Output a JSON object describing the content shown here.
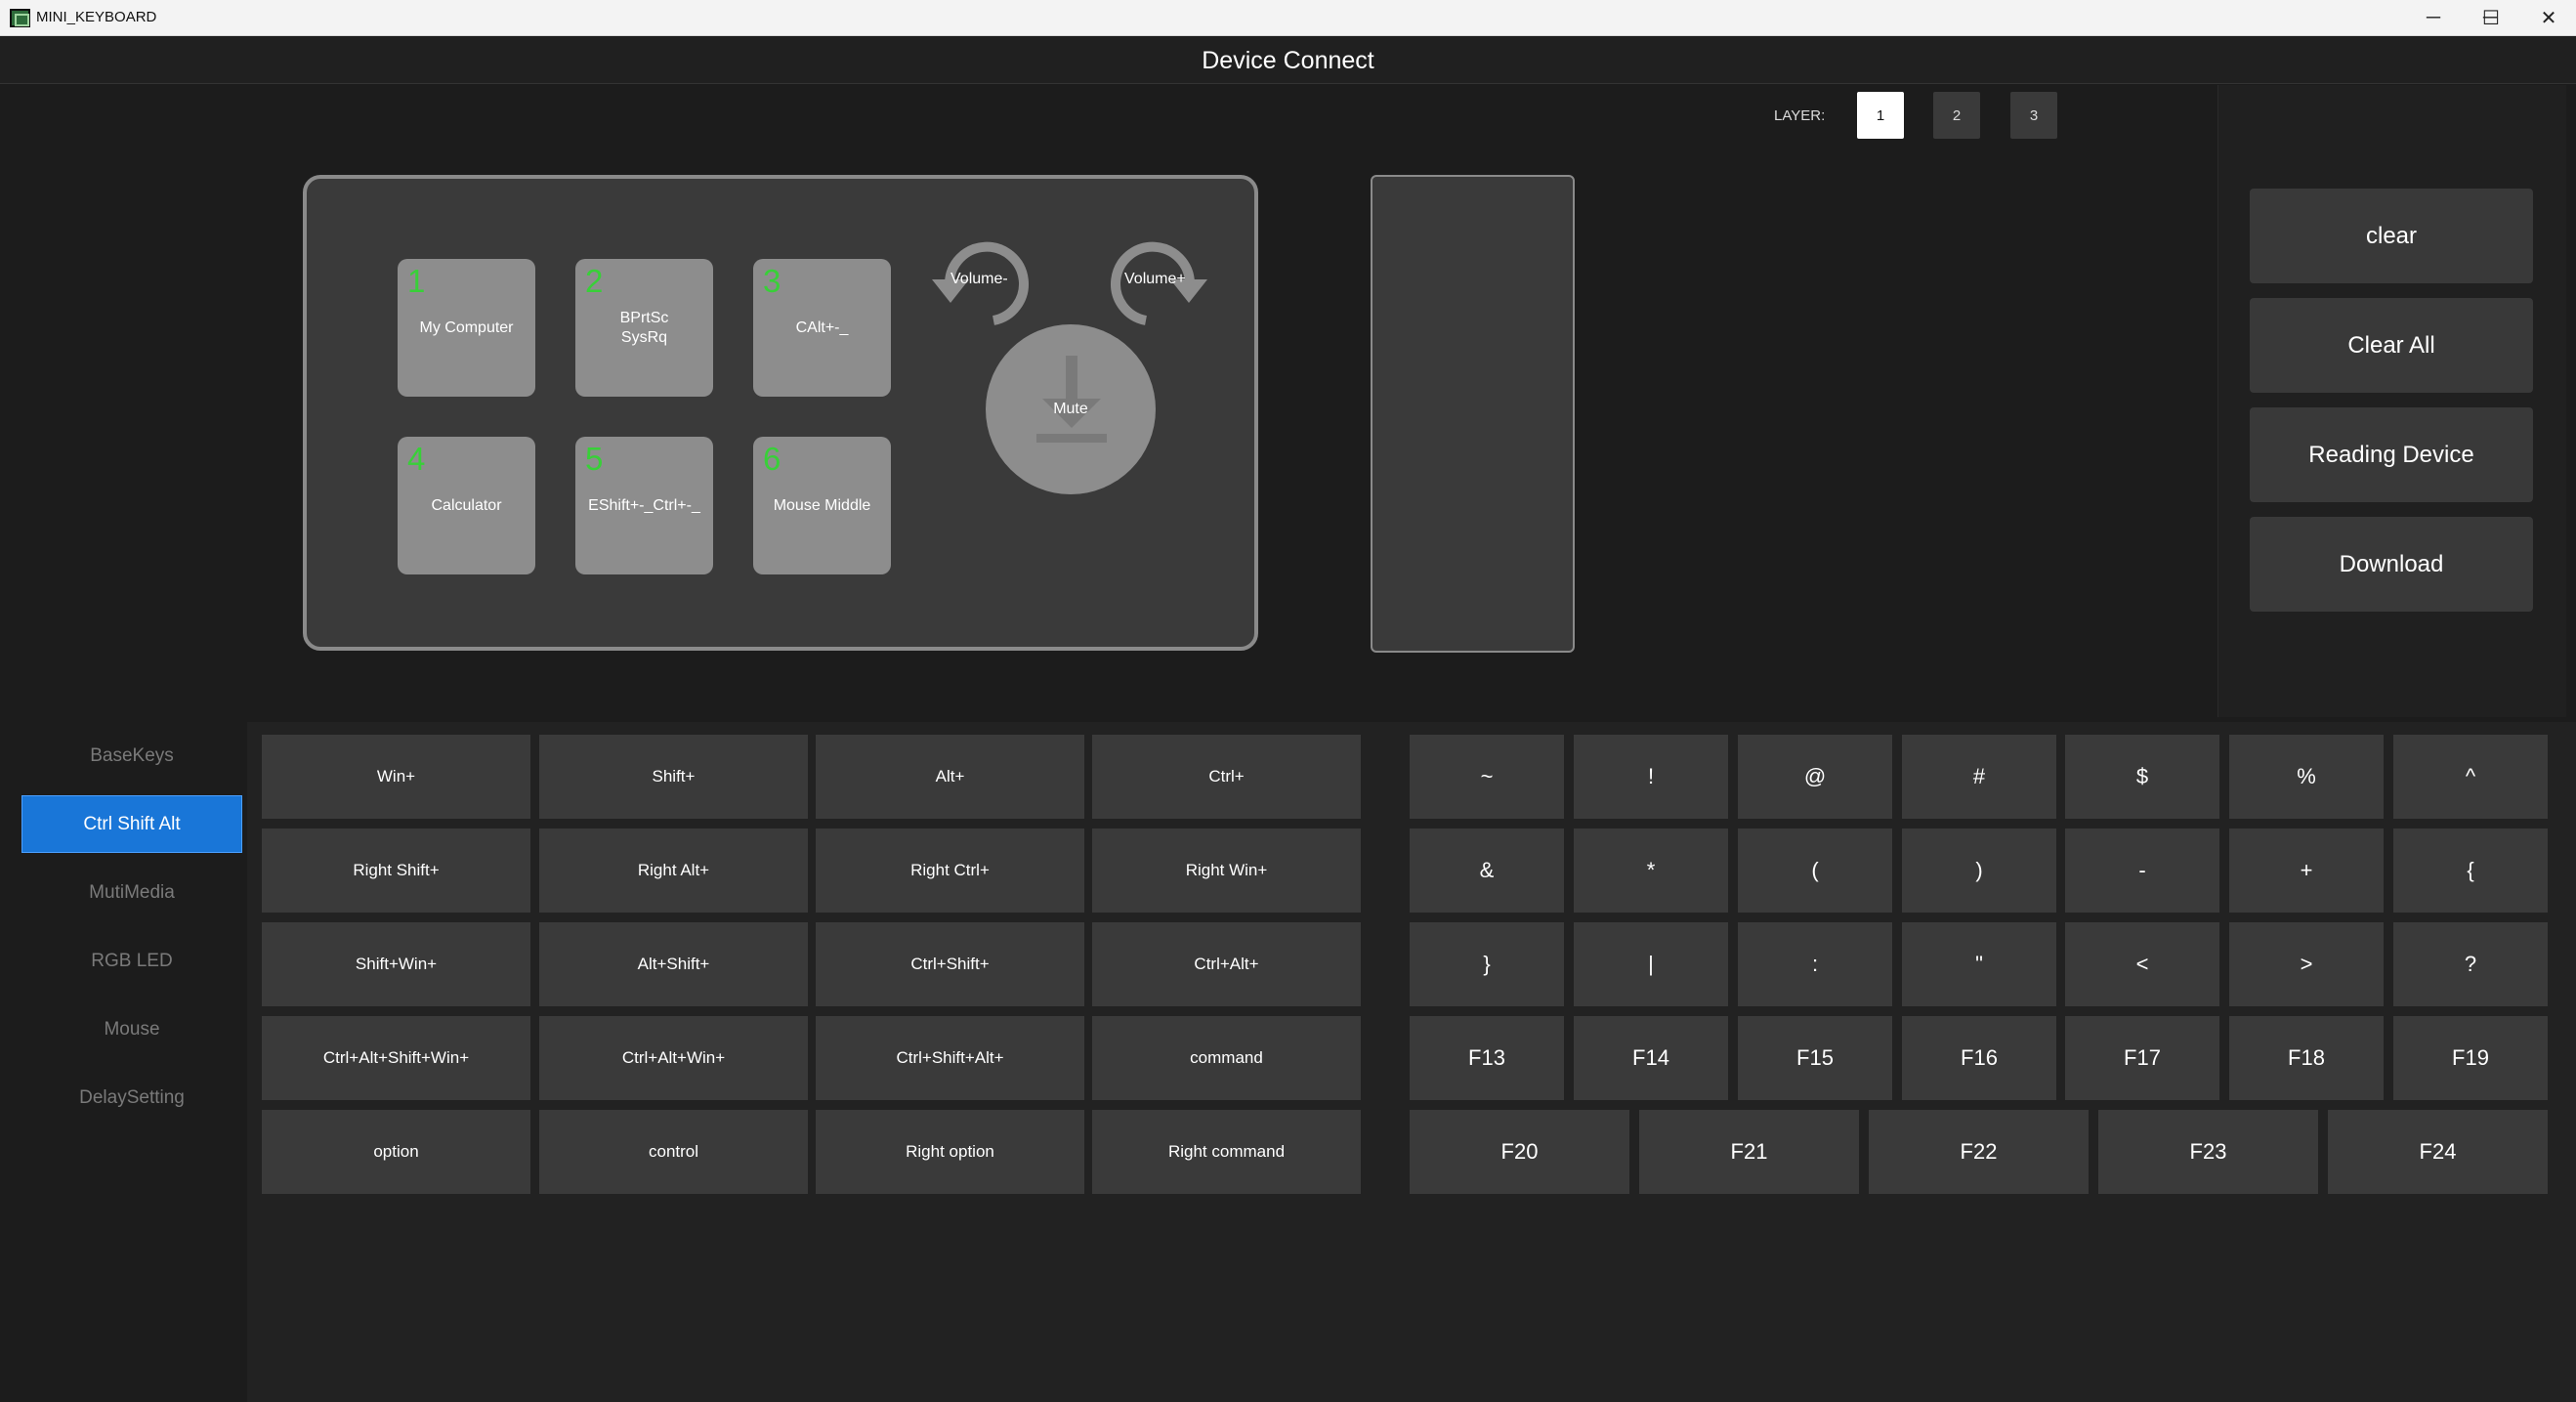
{
  "window": {
    "title": "MINI_KEYBOARD",
    "controls": {
      "minimize": "─",
      "maximize": "☐",
      "close": "✕"
    }
  },
  "header": {
    "title": "Device Connect"
  },
  "layer": {
    "label": "LAYER:",
    "options": [
      "1",
      "2",
      "3"
    ],
    "selected": "1"
  },
  "device": {
    "keys": [
      {
        "num": "1",
        "label": "My Computer"
      },
      {
        "num": "2",
        "label": "BPrtSc\nSysRq"
      },
      {
        "num": "3",
        "label": "CAlt+-_"
      },
      {
        "num": "4",
        "label": "Calculator"
      },
      {
        "num": "5",
        "label": "EShift+-_Ctrl+-_"
      },
      {
        "num": "6",
        "label": "Mouse Middle"
      }
    ],
    "knob": {
      "left_label": "Volume-",
      "right_label": "Volume+",
      "press_label": "Mute"
    }
  },
  "actions": {
    "clear": "clear",
    "clear_all": "Clear All",
    "reading_device": "Reading Device",
    "download": "Download"
  },
  "sidebar": {
    "items": [
      "BaseKeys",
      "Ctrl Shift Alt",
      "MutiMedia",
      "RGB LED",
      "Mouse",
      "DelaySetting"
    ],
    "selected": "Ctrl Shift Alt"
  },
  "modifiers": [
    [
      "Win+",
      "Shift+",
      "Alt+",
      "Ctrl+"
    ],
    [
      "Right Shift+",
      "Right Alt+",
      "Right Ctrl+",
      "Right Win+"
    ],
    [
      "Shift+Win+",
      "Alt+Shift+",
      "Ctrl+Shift+",
      "Ctrl+Alt+"
    ],
    [
      "Ctrl+Alt+Shift+Win+",
      "Ctrl+Alt+Win+",
      "Ctrl+Shift+Alt+",
      "command"
    ],
    [
      "option",
      "control",
      "Right option",
      "Right command"
    ]
  ],
  "symbols": [
    [
      "~",
      "!",
      "@",
      "#",
      "$",
      "%",
      "^"
    ],
    [
      "&",
      "*",
      "(",
      ")",
      "-",
      "+",
      "{"
    ],
    [
      "}",
      "|",
      ":",
      "\"",
      "<",
      ">",
      "?"
    ],
    [
      "F13",
      "F14",
      "F15",
      "F16",
      "F17",
      "F18",
      "F19"
    ]
  ],
  "function_keys": [
    "F20",
    "F21",
    "F22",
    "F23",
    "F24"
  ],
  "colors": {
    "accent": "#1976d8",
    "key_number": "#38d038"
  }
}
